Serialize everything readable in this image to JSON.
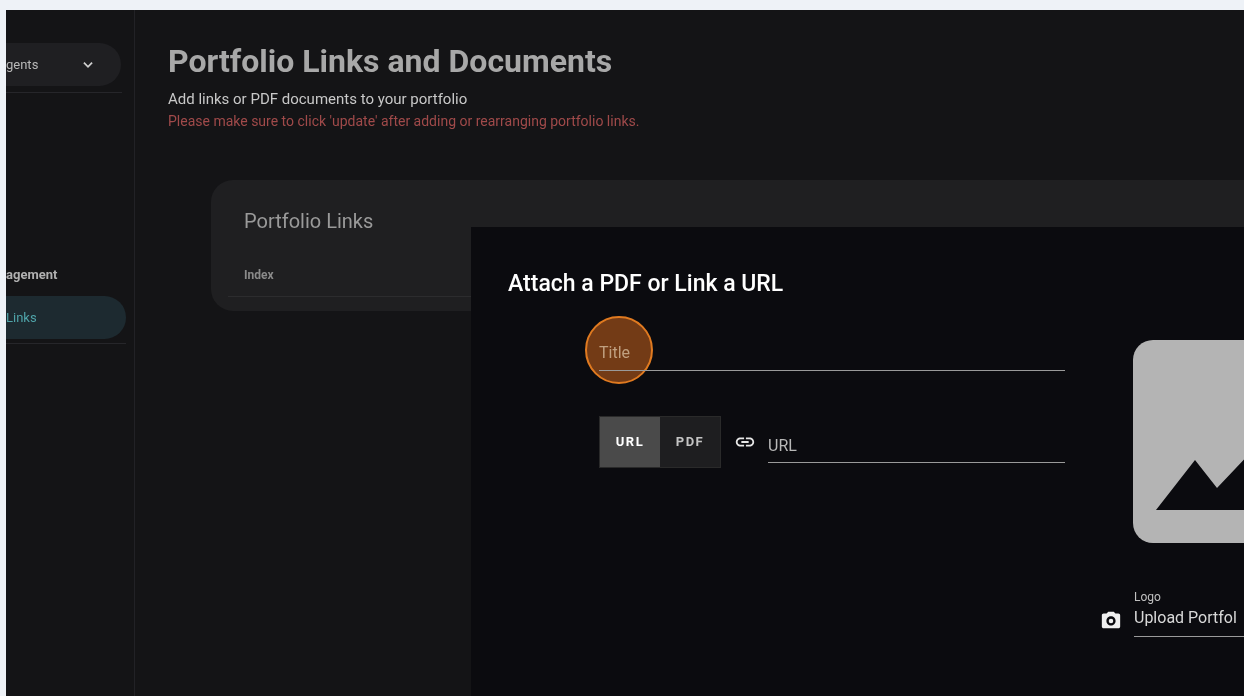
{
  "sidebar": {
    "dropdown": {
      "label": "gents",
      "expanded": false
    },
    "items": [
      {
        "label": "agement",
        "selected": false
      },
      {
        "label": "Links",
        "selected": true
      }
    ]
  },
  "page": {
    "title": "Portfolio Links and Documents",
    "subtitle": "Add links or PDF documents to your portfolio",
    "warning": "Please make sure to click 'update' after adding or rearranging portfolio links."
  },
  "card": {
    "title": "Portfolio Links",
    "columns": [
      "Index"
    ]
  },
  "dialog": {
    "title": "Attach a PDF or Link a URL",
    "title_field": {
      "placeholder": "Title"
    },
    "source_toggle": [
      {
        "label": "URL",
        "selected": true
      },
      {
        "label": "PDF",
        "selected": false
      }
    ],
    "url_field": {
      "placeholder": "URL"
    },
    "logo": {
      "label": "Logo",
      "value": "Upload Portfol"
    }
  }
}
